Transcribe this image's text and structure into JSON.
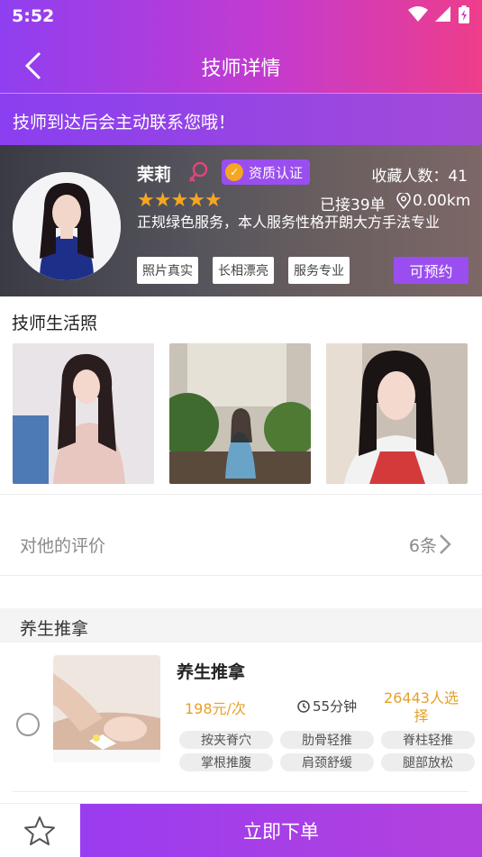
{
  "status_bar": {
    "time": "5:52",
    "icons": [
      "wifi-icon",
      "signal-icon",
      "battery-icon"
    ]
  },
  "nav": {
    "title": "技师详情",
    "back_icon": "chevron-left-icon"
  },
  "notice": {
    "text": "技师到达后会主动联系您哦！"
  },
  "profile": {
    "name": "茉莉",
    "gender_icon": "female-icon",
    "certification": "资质认证",
    "favorites_label": "收藏人数：41",
    "rating_stars": 5,
    "orders": "已接39单",
    "distance": "0.00km",
    "description": "正规绿色服务，本人服务性格开朗大方手法专业",
    "tags": [
      "照片真实",
      "长相漂亮",
      "服务专业"
    ],
    "book_label": "可预约"
  },
  "life_photos": {
    "title": "技师生活照",
    "count": 3
  },
  "reviews": {
    "label": "对他的评价",
    "count": "6条"
  },
  "service_section": {
    "title": "养生推拿"
  },
  "service": {
    "name": "养生推拿",
    "price": "198元/次",
    "duration": "55分钟",
    "selected_count": "26443人选择",
    "chips": [
      "按夹脊穴",
      "肋骨轻推",
      "脊柱轻推",
      "掌根推腹",
      "肩颈舒缓",
      "腿部放松"
    ]
  },
  "bottom": {
    "order_label": "立即下单",
    "favorite_icon": "star-outline-icon"
  },
  "colors": {
    "primary": "#9a4ef0",
    "accent_orange": "#e7a128",
    "gradient_end": "#ee3d8a"
  }
}
